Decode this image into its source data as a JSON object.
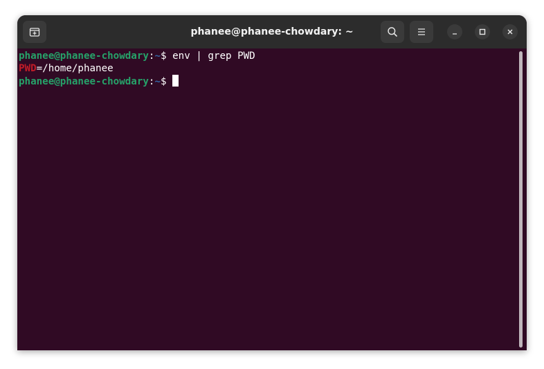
{
  "window": {
    "title": "phanee@phanee-chowdary: ~"
  },
  "icons": {
    "new_tab": "new-tab-icon",
    "search": "search-icon",
    "menu": "hamburger-menu-icon",
    "minimize": "minimize-icon",
    "maximize": "maximize-icon",
    "close": "close-icon"
  },
  "terminal": {
    "lines": [
      {
        "prompt_user": "phanee@phanee-chowdary",
        "prompt_colon": ":",
        "prompt_dir": "~",
        "prompt_symbol": "$ ",
        "command": "env | grep PWD"
      },
      {
        "match": "PWD",
        "rest": "=/home/phanee"
      },
      {
        "prompt_user": "phanee@phanee-chowdary",
        "prompt_colon": ":",
        "prompt_dir": "~",
        "prompt_symbol": "$ ",
        "command": ""
      }
    ]
  },
  "colors": {
    "background": "#300a24",
    "titlebar": "#2c2c2c",
    "prompt_user": "#26a269",
    "prompt_dir": "#3465a4",
    "grep_match": "#c01c28",
    "text": "#ffffff"
  }
}
